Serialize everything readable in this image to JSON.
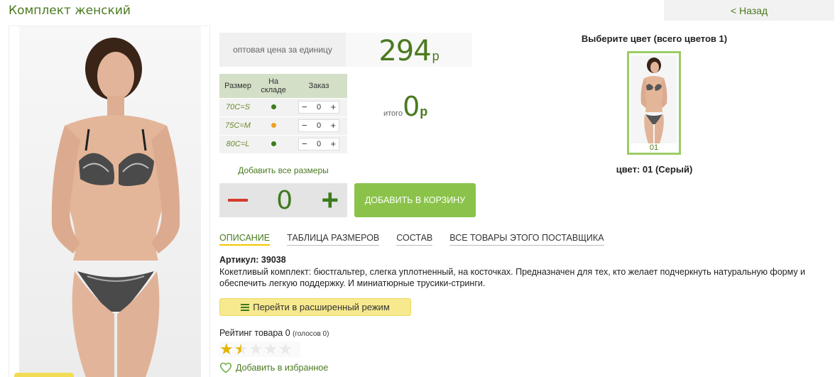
{
  "page": {
    "title": "Комплект женский",
    "back_label": "< Назад"
  },
  "price": {
    "label": "оптовая цена за единицу",
    "value": "294",
    "currency": "р"
  },
  "sizes": {
    "headers": [
      "Размер",
      "На складе",
      "Заказ"
    ],
    "rows": [
      {
        "size": "70C=S",
        "stock": "green",
        "qty": "0"
      },
      {
        "size": "75C=M",
        "stock": "orange",
        "qty": "0"
      },
      {
        "size": "80C=L",
        "stock": "green",
        "qty": "0"
      }
    ],
    "add_all_label": "Добавить все размеры"
  },
  "total": {
    "label": "итого",
    "value": "0",
    "currency": "р"
  },
  "quantity": {
    "value": "0",
    "minus_icon": "minus",
    "plus_label": "+"
  },
  "cart": {
    "button_label": "ДОБАВИТЬ В КОРЗИНУ",
    "color": "#8bc34a"
  },
  "tabs": [
    "ОПИСАНИЕ",
    "ТАБЛИЦА РАЗМЕРОВ",
    "СОСТАВ",
    "ВСЕ ТОВАРЫ ЭТОГО ПОСТАВЩИКА"
  ],
  "article": {
    "label": "Артикул: 39038"
  },
  "description": "Кокетливый комплект: бюстгальтер, слегка уплотненный, на косточках. Предназначен для тех, кто желает подчеркнуть натуральную форму и обеспечить легкую поддержку. И миниатюрные трусики-стринги.",
  "extended_mode": {
    "label": "Перейти в расширенный режим",
    "icon": "list-icon"
  },
  "rating": {
    "label": "Рейтинг товара 0",
    "votes": "(голосов 0)",
    "stars_value": 1.5,
    "stars_max": 5
  },
  "favorite": {
    "label": "Добавить в избранное",
    "icon": "heart-icon"
  },
  "colors": {
    "title": "Выберите цвет (всего цветов 1)",
    "items": [
      {
        "code": "01"
      }
    ],
    "current": "цвет: 01 (Серый)"
  },
  "theme": {
    "accent": "#4a7a1f",
    "highlight": "#f0c800"
  }
}
